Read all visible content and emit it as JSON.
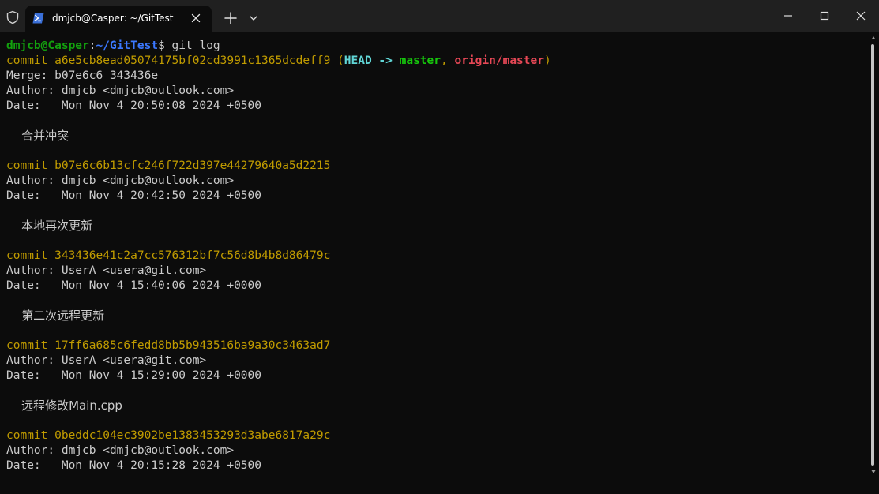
{
  "window": {
    "tab_title": "dmjcb@Casper: ~/GitTest",
    "icons": [
      "shield-icon",
      "powershell-icon",
      "close-icon",
      "plus-icon",
      "chevron-down-icon",
      "minimize-icon",
      "maximize-icon",
      "close-window-icon"
    ]
  },
  "prompt": {
    "user_host": "dmjcb@Casper",
    "colon": ":",
    "path": "~/GitTest",
    "dollar": "$",
    "command": " git log"
  },
  "refs": {
    "open": " (",
    "head": "HEAD ->",
    "branch": "master",
    "sep": ",",
    "remote": "origin/master",
    "close": ")"
  },
  "commits": [
    {
      "hash_line": "commit a6e5cb8ead05074175bf02cd3991c1365dcdeff9",
      "merge": "Merge: b07e6c6 343436e",
      "author": "Author: dmjcb <dmjcb@outlook.com>",
      "date": "Date:   Mon Nov 4 20:50:08 2024 +0500",
      "message": "    合并冲突"
    },
    {
      "hash_line": "commit b07e6c6b13cfc246f722d397e44279640a5d2215",
      "author": "Author: dmjcb <dmjcb@outlook.com>",
      "date": "Date:   Mon Nov 4 20:42:50 2024 +0500",
      "message": "    本地再次更新"
    },
    {
      "hash_line": "commit 343436e41c2a7cc576312bf7c56d8b4b8d86479c",
      "author": "Author: UserA <usera@git.com>",
      "date": "Date:   Mon Nov 4 15:40:06 2024 +0000",
      "message": "    第二次远程更新"
    },
    {
      "hash_line": "commit 17ff6a685c6fedd8bb5b943516ba9a30c3463ad7",
      "author": "Author: UserA <usera@git.com>",
      "date": "Date:   Mon Nov 4 15:29:00 2024 +0000",
      "message": "    远程修改Main.cpp"
    },
    {
      "hash_line": "commit 0beddc104ec3902be1383453293d3abe6817a29c",
      "author": "Author: dmjcb <dmjcb@outlook.com>",
      "date": "Date:   Mon Nov 4 20:15:28 2024 +0500"
    }
  ],
  "colors": {
    "background": "#0c0c0c",
    "titlebar": "#202020",
    "prompt_user": "#13a10e",
    "prompt_path": "#3b78ff",
    "commit_hash": "#c19c00",
    "head": "#61d6d6",
    "branch": "#16c60c",
    "remote": "#e74856",
    "text": "#cccccc"
  }
}
